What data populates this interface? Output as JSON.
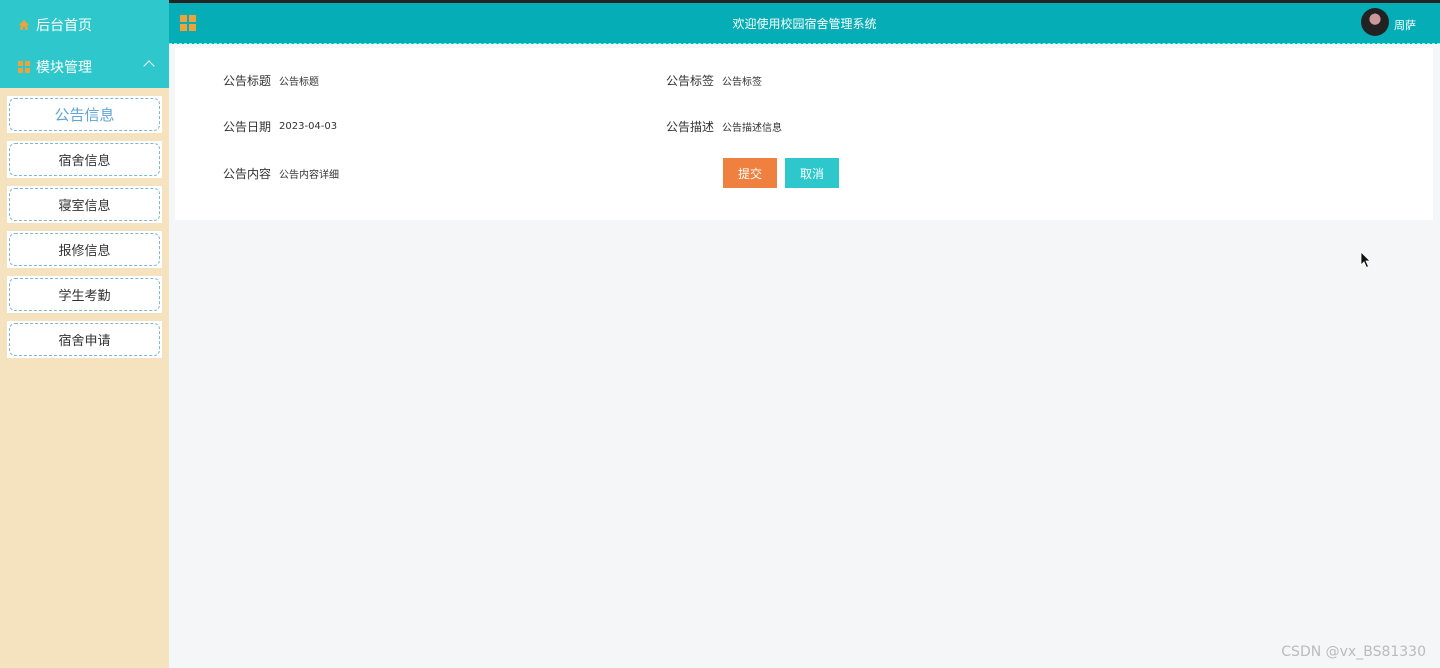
{
  "sidebar": {
    "home_label": "后台首页",
    "modules_label": "模块管理",
    "items": [
      {
        "label": "公告信息"
      },
      {
        "label": "宿舍信息"
      },
      {
        "label": "寝室信息"
      },
      {
        "label": "报修信息"
      },
      {
        "label": "学生考勤"
      },
      {
        "label": "宿舍申请"
      }
    ]
  },
  "header": {
    "title": "欢迎使用校园宿舍管理系统",
    "username": "周萨"
  },
  "form": {
    "title_label": "公告标题",
    "title_value": "公告标题",
    "tag_label": "公告标签",
    "tag_value": "公告标签",
    "date_label": "公告日期",
    "date_value": "2023-04-03",
    "desc_label": "公告描述",
    "desc_value": "公告描述信息",
    "content_label": "公告内容",
    "content_value": "公告内容详细",
    "submit_label": "提交",
    "cancel_label": "取消"
  },
  "watermark": "CSDN @vx_BS81330",
  "colors": {
    "sidebar_bg": "#f5e3c0",
    "header_bg": "#05aeb6",
    "accent_teal": "#2ec8cc",
    "submit_orange": "#f08040",
    "icon_orange": "#f0a23a"
  }
}
